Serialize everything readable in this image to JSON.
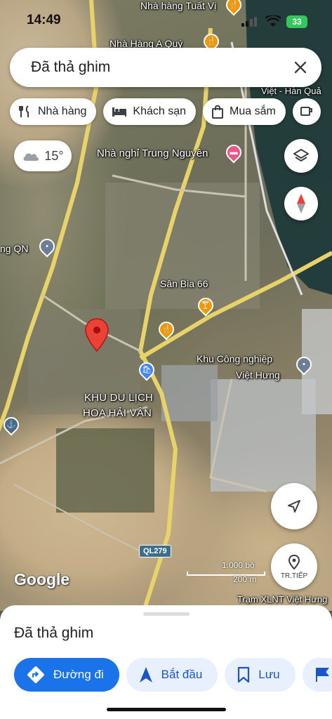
{
  "status_bar": {
    "time": "14:49",
    "battery": "33"
  },
  "search": {
    "value": "Đã thả ghim"
  },
  "chips": [
    {
      "label": "Nhà hàng",
      "icon": "fork-knife-icon"
    },
    {
      "label": "Khách sạn",
      "icon": "bed-icon"
    },
    {
      "label": "Mua sắm",
      "icon": "shopping-bag-icon"
    }
  ],
  "weather": {
    "temperature": "15°",
    "icon": "cloud-icon"
  },
  "map_labels": {
    "restaurant_tuat_vi": "Nhà hàng Tuất Vị",
    "restaurant_a_quy": "Nhà Hàng A Quý",
    "nha_nghi": "Nhà nghỉ Trung Nguyên",
    "cong_qn": "ng QN",
    "san_bia": "Sân Bia 66",
    "khu_cong_nghiep_1": "Khu Công nghiệp",
    "khu_cong_nghiep_2": "Việt Hưng",
    "khu_du_lich_1": "KHU DU LỊCH",
    "khu_du_lich_2": "HOA HẢI VÂN",
    "road": "QL279",
    "tram": "Trạm XLNT Việt Hưng",
    "viet_han": "Việt - Hàn Quả"
  },
  "map_controls": {
    "tr_tiep_label": "TR.TIẾP"
  },
  "scale": {
    "top": "1.000 bộ",
    "bottom": "200 m"
  },
  "google_logo": "Google",
  "sheet": {
    "title": "Đã thả ghim",
    "actions": [
      {
        "label": "Đường đi",
        "icon": "directions-icon"
      },
      {
        "label": "Bắt đầu",
        "icon": "navigation-arrow-icon"
      },
      {
        "label": "Lưu",
        "icon": "bookmark-icon"
      }
    ]
  },
  "colors": {
    "primary_blue": "#1a73e8",
    "pin_red": "#ea4335",
    "poi_orange": "#f29900",
    "poi_pink": "#e8598a",
    "road_yellow": "#e8d26a"
  }
}
